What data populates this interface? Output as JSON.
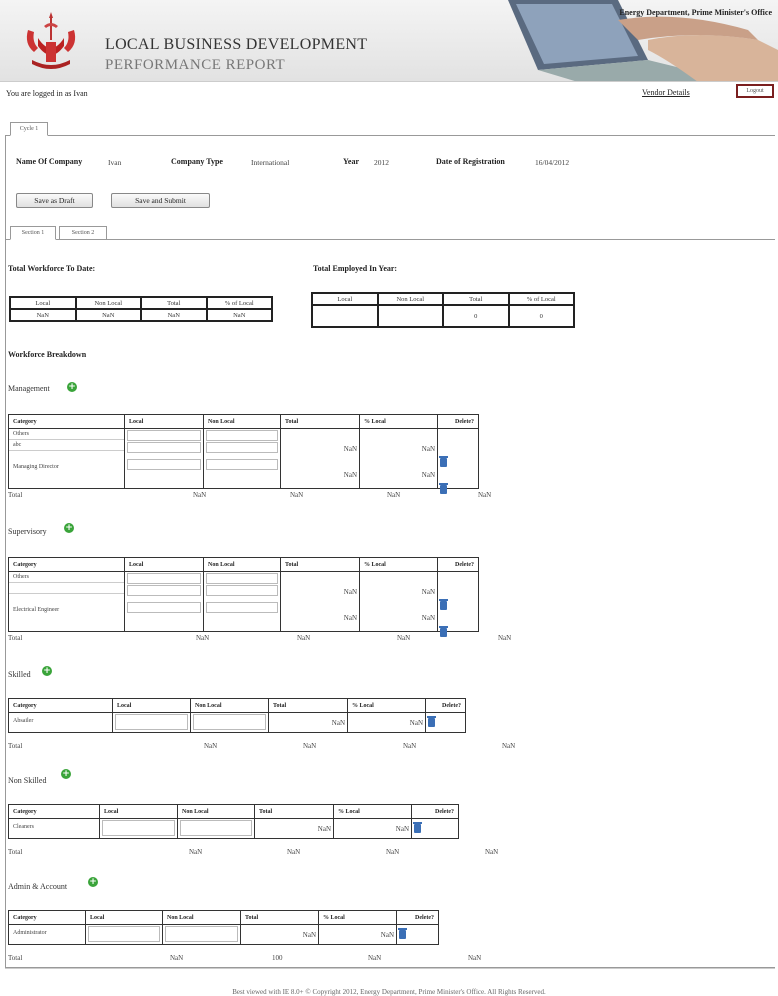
{
  "header": {
    "title_line1": "LOCAL BUSINESS DEVELOPMENT",
    "title_line2": "PERFORMANCE REPORT",
    "department": "Energy Department, Prime Minister's Office"
  },
  "user": {
    "logged_in_text": "You are logged in as Ivan",
    "vendor_link": "Vendor Details",
    "logout_label": "Logout"
  },
  "cycle_tab": "Cycle 1",
  "company": {
    "name_label": "Name Of Company",
    "name_value": "Ivan",
    "type_label": "Company Type",
    "type_value": "International",
    "year_label": "Year",
    "year_value": "2012",
    "reg_label": "Date of Registration",
    "reg_value": "16/04/2012"
  },
  "actions": {
    "draft": "Save as Draft",
    "submit": "Save and Submit"
  },
  "sections": [
    "Section 1",
    "Section 2"
  ],
  "summary": {
    "workforce_title": "Total Workforce To Date:",
    "employed_title": "Total Employed In Year:",
    "headers": [
      "Local",
      "Non Local",
      "Total",
      "% of Local"
    ],
    "workforce_values": [
      "NaN",
      "NaN",
      "NaN",
      "NaN"
    ],
    "employed_values": [
      "",
      "",
      "0",
      "0"
    ]
  },
  "breakdown_title": "Workforce Breakdown",
  "columns": [
    "Category",
    "Local",
    "Non Local",
    "Total",
    "% Local",
    "Delete?"
  ],
  "total_label": "Total",
  "groups": [
    {
      "name": "Management",
      "rows": [
        [
          "Others",
          "abc"
        ],
        [
          "Managing Director"
        ]
      ],
      "nums": [
        "NaN",
        "NaN",
        "NaN",
        "NaN"
      ],
      "totals": [
        "NaN",
        "NaN",
        "NaN",
        "NaN"
      ]
    },
    {
      "name": "Supervisory",
      "rows": [
        [
          "Others",
          ""
        ],
        [
          "Electrical Engineer"
        ]
      ],
      "nums": [
        "NaN",
        "NaN",
        "NaN",
        "NaN"
      ],
      "totals": [
        "NaN",
        "NaN",
        "NaN",
        "NaN"
      ]
    },
    {
      "name": "Skilled",
      "rows": [
        [
          "Absailer"
        ]
      ],
      "nums": [
        "NaN",
        "NaN"
      ],
      "totals": [
        "NaN",
        "NaN",
        "NaN",
        "NaN"
      ]
    },
    {
      "name": "Non Skilled",
      "rows": [
        [
          "Cleaners"
        ]
      ],
      "nums": [
        "NaN",
        "NaN"
      ],
      "totals": [
        "NaN",
        "NaN",
        "NaN",
        "NaN"
      ]
    },
    {
      "name": "Admin & Account",
      "rows": [
        [
          "Administrator"
        ]
      ],
      "nums": [
        "NaN",
        "NaN"
      ],
      "totals": [
        "NaN",
        "100",
        "NaN",
        "NaN"
      ]
    }
  ],
  "footer": "Best viewed with IE 8.0+ © Copyright 2012, Energy Department, Prime Minister's Office. All Rights Reserved.",
  "icons": {
    "add": "plus-circle-icon",
    "delete": "trash-icon",
    "emblem": "crest-emblem"
  }
}
